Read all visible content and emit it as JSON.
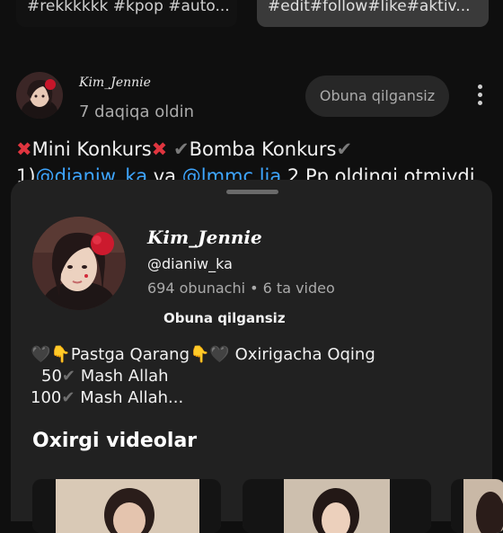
{
  "top_chips": [
    {
      "text": "#rekkkkkk #kpop #auto..."
    },
    {
      "text": "#edit#follow#like#aktiv..."
    }
  ],
  "post": {
    "author": "Kim_Jennie",
    "time": "7 daqiqa oldin",
    "subscribe_label": "Obuna qilgansiz",
    "line1_a": "Mini Konkurs",
    "line1_b": "Bomba Konkurs",
    "line2_prefix": "1)",
    "line2_link1": "@dianiw_ka",
    "line2_mid": " va ",
    "line2_link2": "@lmmc.lia",
    "line2_suffix": " 2 Pp oldingi otmiydi"
  },
  "sheet": {
    "channel_name": "Kim_Jennie",
    "handle": "@dianiw_ka",
    "stats": "694 obunachi • 6 ta video",
    "subscribed_label": "Obuna qilgansiz",
    "desc_line1_a": "Pastga Qarang",
    "desc_line1_b": "Oxirigacha Oqing",
    "desc_line2_num": "50",
    "desc_line2_text": "Mash Allah",
    "desc_line3_num": "100",
    "desc_line3_text": "Mash Allah...",
    "section_title": "Oxirgi videolar"
  },
  "icons": {
    "kebab": "more-vert-icon",
    "cross": "cross-mark-emoji",
    "check": "check-mark-emoji",
    "heart": "black-heart-emoji",
    "pointing": "pointing-down-emoji"
  },
  "colors": {
    "background": "#0f0f0f",
    "sheet": "#212121",
    "link": "#3ea6ff",
    "cross": "#e0353f"
  }
}
